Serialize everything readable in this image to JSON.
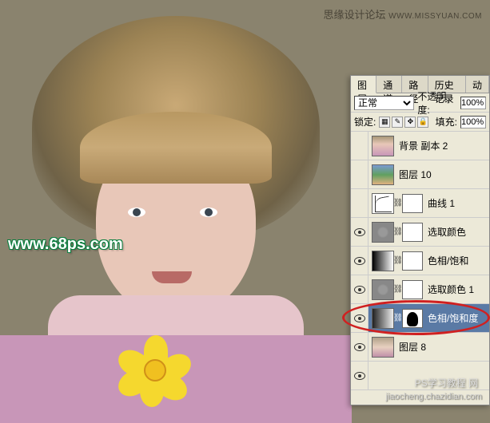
{
  "top_watermark": {
    "site": "思缘设计论坛",
    "url": "WWW.MISSYUAN.COM"
  },
  "center_watermark": "www.68ps.com",
  "bottom_watermark1": "PS学习教程 网",
  "bottom_watermark2": "jiaocheng.chazidian.com",
  "panel": {
    "tabs": {
      "layers": "图层",
      "channels": "通道",
      "paths": "路径",
      "history": "历史记录",
      "actions": "动"
    },
    "blend_mode": "正常",
    "opacity_label": "不透明度:",
    "opacity_value": "100%",
    "lock_label": "锁定:",
    "fill_label": "填充:",
    "fill_value": "100%"
  },
  "layers": [
    {
      "vis": false,
      "name": "背景 副本 2",
      "thumb": "photo"
    },
    {
      "vis": false,
      "name": "图层 10",
      "thumb": "photo2"
    },
    {
      "vis": false,
      "name": "曲线 1",
      "thumb": "curves",
      "mask": "white",
      "indent": true
    },
    {
      "vis": true,
      "name": "选取颜色",
      "thumb": "selcolor",
      "mask": "white",
      "indent": true
    },
    {
      "vis": true,
      "name": "色相/饱和",
      "thumb": "huesat",
      "mask": "white",
      "indent": true
    },
    {
      "vis": true,
      "name": "选取颜色 1",
      "thumb": "selcolor",
      "mask": "white",
      "indent": true
    },
    {
      "vis": true,
      "name": "色相/饱和度",
      "thumb": "gradmap",
      "mask": "sil",
      "selected": true
    },
    {
      "vis": true,
      "name": "图层 8",
      "thumb": "photo3"
    },
    {
      "vis": true,
      "name": "",
      "thumb": ""
    }
  ]
}
